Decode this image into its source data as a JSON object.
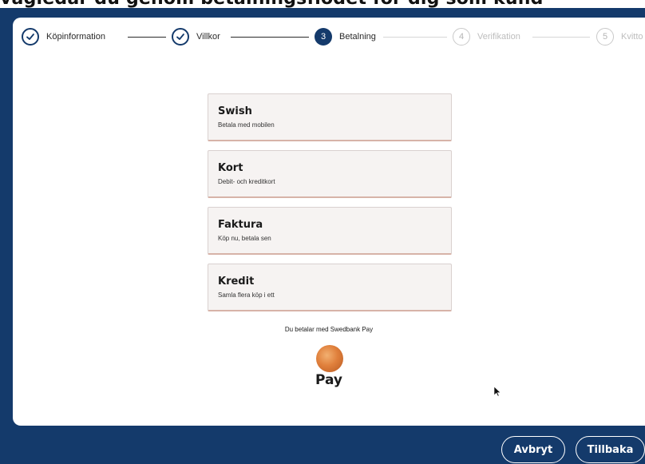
{
  "top_strip_text": "vägledar du genom betalningsflödet för dig som kund",
  "stepper": [
    {
      "number": "",
      "label": "Köpinformation",
      "state": "done"
    },
    {
      "number": "",
      "label": "Villkor",
      "state": "done"
    },
    {
      "number": "3",
      "label": "Betalning",
      "state": "active"
    },
    {
      "number": "4",
      "label": "Verifikation",
      "state": "pending"
    },
    {
      "number": "5",
      "label": "Kvitto",
      "state": "pending"
    }
  ],
  "payment_options": [
    {
      "title": "Swish",
      "subtitle": "Betala med mobilen"
    },
    {
      "title": "Kort",
      "subtitle": "Debit- och kreditkort"
    },
    {
      "title": "Faktura",
      "subtitle": "Köp nu, betala sen"
    },
    {
      "title": "Kredit",
      "subtitle": "Samla flera köp i ett"
    }
  ],
  "pay_with_text": "Du betalar med Swedbank Pay",
  "logo_text": "Pay",
  "buttons": {
    "cancel": "Avbryt",
    "back": "Tillbaka"
  },
  "colors": {
    "navy": "#143a6b",
    "option_bg": "#f6f3f2",
    "option_border": "#d7b3a8"
  }
}
